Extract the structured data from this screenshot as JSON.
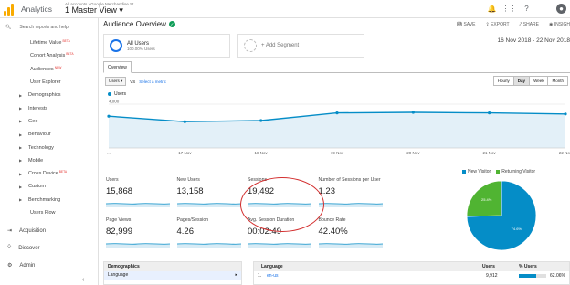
{
  "topbar": {
    "app_name": "Analytics",
    "account_crumb": "All accounts › Google Merchandise St...",
    "view_name": "1 Master View ▾",
    "icons": [
      "bell-icon",
      "apps-icon",
      "help-icon",
      "more-icon",
      "avatar"
    ]
  },
  "sidebar": {
    "search_placeholder": "Search reports and help",
    "items": [
      {
        "label": "Lifetime Value",
        "badge": "BETA",
        "type": "sub"
      },
      {
        "label": "Cohort Analysis",
        "badge": "BETA",
        "type": "sub"
      },
      {
        "label": "Audiences",
        "badge": "NEW",
        "type": "sub"
      },
      {
        "label": "User Explorer",
        "badge": "",
        "type": "sub"
      },
      {
        "label": "Demographics",
        "badge": "",
        "type": "grp"
      },
      {
        "label": "Interests",
        "badge": "",
        "type": "grp"
      },
      {
        "label": "Geo",
        "badge": "",
        "type": "grp"
      },
      {
        "label": "Behaviour",
        "badge": "",
        "type": "grp"
      },
      {
        "label": "Technology",
        "badge": "",
        "type": "grp"
      },
      {
        "label": "Mobile",
        "badge": "",
        "type": "grp"
      },
      {
        "label": "Cross Device",
        "badge": "BETA",
        "type": "grp"
      },
      {
        "label": "Custom",
        "badge": "",
        "type": "grp"
      },
      {
        "label": "Benchmarking",
        "badge": "",
        "type": "grp"
      },
      {
        "label": "Users Flow",
        "badge": "",
        "type": "sub"
      }
    ],
    "main_items": [
      {
        "label": "Acquisition",
        "icon": "acquisition-icon"
      },
      {
        "label": "Discover",
        "icon": "lightbulb-icon"
      },
      {
        "label": "Admin",
        "icon": "gear-icon"
      }
    ]
  },
  "report": {
    "title": "Audience Overview",
    "actions": [
      "SAVE",
      "EXPORT",
      "SHARE",
      "INSIGH"
    ],
    "segment1_title": "All Users",
    "segment1_sub": "100.00% Users",
    "segment2_label": "+ Add Segment",
    "date_range": "16 Nov 2018 - 22 Nov 2018",
    "tab": "Overview",
    "metric_select": "Users ▾",
    "vs": "VS",
    "select_metric": "Select a metric",
    "granularity": [
      "Hourly",
      "Day",
      "Week",
      "Month"
    ],
    "granularity_selected": "Day"
  },
  "chart_data": {
    "type": "area",
    "series": [
      {
        "name": "Users",
        "values": [
          2900,
          2400,
          2500,
          3200,
          3250,
          3200,
          3100
        ]
      }
    ],
    "x": [
      "...",
      "17 Nov",
      "18 Nov",
      "19 Nov",
      "20 Nov",
      "21 Nov",
      "22 Nov"
    ],
    "yticks": [
      "4,000",
      "2,000"
    ],
    "ylim": [
      0,
      4000
    ],
    "color": "#058dc7"
  },
  "metrics": [
    {
      "label": "Users",
      "value": "15,868"
    },
    {
      "label": "New Users",
      "value": "13,158"
    },
    {
      "label": "Sessions",
      "value": "19,492"
    },
    {
      "label": "Number of Sessions per User",
      "value": "1.23"
    },
    {
      "label": "Page Views",
      "value": "82,999"
    },
    {
      "label": "Pages/Session",
      "value": "4.26"
    },
    {
      "label": "Avg. Session Duration",
      "value": "00:02:49"
    },
    {
      "label": "Bounce Rate",
      "value": "42.40%"
    }
  ],
  "pie": {
    "legend": [
      {
        "label": "New Visitor",
        "color": "#058dc7"
      },
      {
        "label": "Returning Visitor",
        "color": "#50b432"
      }
    ],
    "slices": [
      {
        "label": "74.6%",
        "value": 74.6,
        "color": "#058dc7"
      },
      {
        "label": "25.4%",
        "value": 25.4,
        "color": "#50b432"
      }
    ]
  },
  "bottom": {
    "left_header": "Demographics",
    "left_row": "Language",
    "left_arrow": "▸",
    "right_col1": "Language",
    "right_col2": "Users",
    "right_col3": "% Users",
    "row_index": "1.",
    "row_lang": "en-us",
    "row_users": "9,912",
    "row_pct": "62.06%",
    "row_pct_value": 62.06
  }
}
